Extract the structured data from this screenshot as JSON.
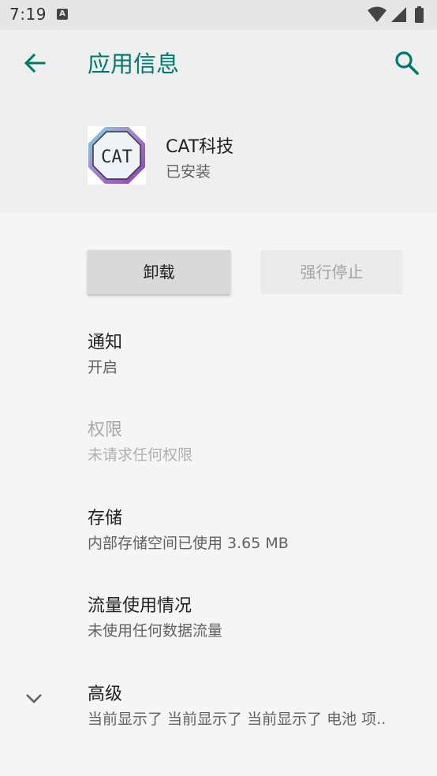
{
  "status_bar": {
    "time": "7:19",
    "notification_icon": "A",
    "icons": [
      "wifi-icon",
      "cell-signal-icon",
      "battery-icon"
    ]
  },
  "app_bar": {
    "title": "应用信息",
    "back_icon": "arrow-left-icon",
    "search_icon": "search-icon",
    "accent_color": "#00796b"
  },
  "app": {
    "name": "CAT科技",
    "status": "已安装",
    "icon_text": "CAT"
  },
  "buttons": {
    "uninstall": "卸载",
    "force_stop": "强行停止"
  },
  "preferences": [
    {
      "title": "通知",
      "summary": "开启",
      "enabled": true
    },
    {
      "title": "权限",
      "summary": "未请求任何权限",
      "enabled": false
    },
    {
      "title": "存储",
      "summary": "内部存储空间已使用 3.65 MB",
      "enabled": true
    },
    {
      "title": "流量使用情况",
      "summary": "未使用任何数据流量",
      "enabled": true
    },
    {
      "title": "高级",
      "summary": "当前显示了 当前显示了 当前显示了 电池 项..",
      "enabled": true,
      "expand_icon": "chevron-down-icon"
    }
  ]
}
